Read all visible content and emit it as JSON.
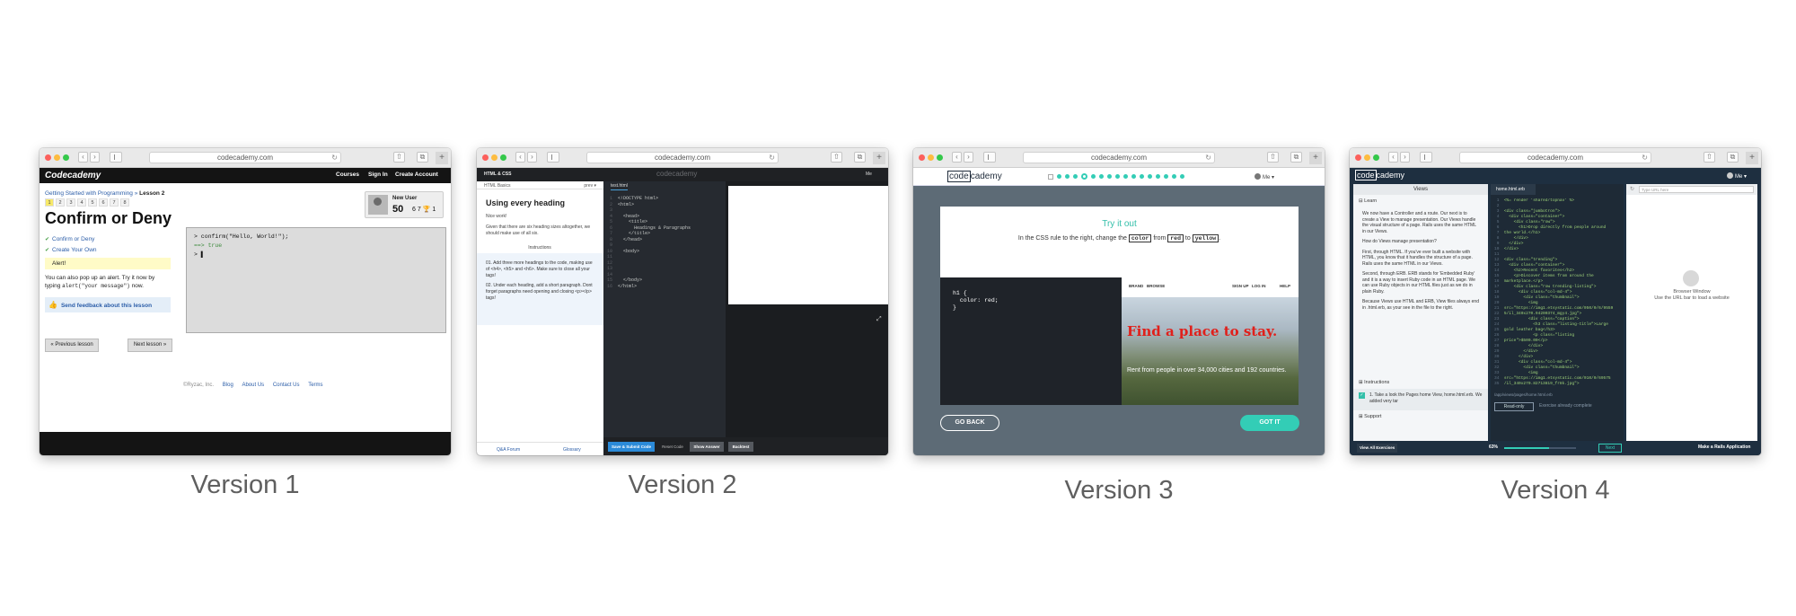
{
  "url": "codecademy.com",
  "captions": [
    "Version 1",
    "Version 2",
    "Version 3",
    "Version 4"
  ],
  "v1": {
    "logo": "Codecademy",
    "nav": [
      "Courses",
      "Sign In",
      "Create Account"
    ],
    "breadcrumb_link": "Getting Started with Programming",
    "breadcrumb_sep": " » ",
    "breadcrumb_current": "Lesson 2",
    "steps": [
      "1",
      "2",
      "3",
      "4",
      "5",
      "6",
      "7",
      "8"
    ],
    "title": "Confirm or Deny",
    "user_name": "New User",
    "points": "50",
    "badges": "6 7 🏆 1",
    "list": [
      "Confirm or Deny",
      "Create Your Own",
      "Alert!"
    ],
    "desc_1": "You can also pop up an alert. Try it now by typing ",
    "desc_code": "alert(\"your message\")",
    "desc_2": " now.",
    "feedback": "Send feedback about this lesson",
    "prev": "« Previous lesson",
    "next": "Next lesson »",
    "console": [
      "> confirm(\"Hello, World!\");",
      "==> true",
      "> ▌"
    ],
    "footer_copy": "©Ryzac, Inc.",
    "footer_links": [
      "Blog",
      "About Us",
      "Contact Us",
      "Terms"
    ]
  },
  "v2": {
    "top_title": "HTML & CSS",
    "logo": "codecademy",
    "me": "Me",
    "course": "HTML Basics",
    "progress": "prev ▾",
    "heading": "Using every heading",
    "p1": "Nice work!",
    "p2": "Given that there are six heading sizes altogether, we should make use of all six.",
    "instructions_label": "Instructions",
    "instr1": "01. Add three more headings to the code, making use of <h4>, <h5> and <h6>. Make sure to close all your tags!",
    "instr2": "02. Under each heading, add a short paragraph. Dont forget paragraphs need opening and closing <p></p> tags!",
    "qa": "Q&A Forum",
    "glossary": "Glossary",
    "tab": "test.html",
    "code": [
      "<!DOCTYPE html>",
      "<html>",
      "",
      "  <head>",
      "    <title>",
      "      Headings & Paragraphs",
      "    </title>",
      "  </head>",
      "",
      "  <body>",
      "",
      "",
      "",
      "",
      "  </body>",
      "</html>"
    ],
    "submit": "Save & Submit Code",
    "reset": "Reset Code",
    "answer": "Show Answer",
    "back": "Backtest"
  },
  "v3": {
    "logo_box": "code",
    "logo_rest": "cademy",
    "me": "Me ▾",
    "try_it": "Try it out",
    "instr_1": "In the CSS rule to the right, change the ",
    "chip_1": "color",
    "instr_2": " from ",
    "chip_2": "red",
    "instr_3": " to ",
    "chip_3": "yellow",
    "instr_4": ".",
    "code": "h1 {\n  color: red;\n}",
    "site_nav": [
      "BRAND",
      "BROWSE",
      "SIGN UP",
      "LOG IN",
      "HELP"
    ],
    "hero_heading": "Find a place to stay.",
    "hero_text": "Rent from people in over 34,000 cities and 192 countries.",
    "go_back": "GO BACK",
    "got_it": "GOT IT"
  },
  "v4": {
    "logo_box": "code",
    "logo_rest": "cademy",
    "me": "Me ▾",
    "views": "Views",
    "learn": "Learn",
    "paragraphs": [
      "We now have a Controller and a route. Our next is to create a View to manage presentation. Our Views handle the visual structure of a page. Rails uses the same HTML in our Views.",
      "How do Views manage presentation?",
      "First, through HTML. If you've ever built a website with HTML, you know that it handles the structure of a page. Rails uses the same HTML in our Views.",
      "Second, through ERB. ERB stands for 'Embedded Ruby' and it is a way to insert Ruby code in an HTML page. We can use Ruby objects in our HTML files just as we do in plain Ruby.",
      "Because Views use HTML and ERB, View files always end in .html.erb, as your see in the file to the right."
    ],
    "instructions": "Instructions",
    "task": "1. Take a look the Pages home View, home.html.erb. We added very tar",
    "support": "Support",
    "file": "home.html.erb",
    "code": [
      "<%= render 'shared/topnav' %>",
      "",
      "<div class=\"jumbotron\">",
      "  <div class=\"container\">",
      "    <div class=\"row\">",
      "      <h1>Drop directly from people around",
      "the world.</h1>",
      "    </div>",
      "  </div>",
      "</div>",
      "",
      "<div class=\"trending\">",
      "  <div class=\"container\">",
      "    <h2>Recent favorites</h2>",
      "    <p>Discover items from around the",
      "marketplace.</p>",
      "    <div class=\"row trending-listing\">",
      "      <div class=\"col-md-4\">",
      "        <div class=\"thumbnail\">",
      "          <img",
      "src=\"https://img1.etsystatic.com/050/0/6/9559",
      "5/il_340x270.94200374_mgy4.jpg\">",
      "          <div class=\"caption\">",
      "            <h3 class=\"listing-title\">Large",
      "gold leather bag</h3>",
      "            <p class=\"listing",
      "price\">$500.00</p>",
      "          </div>",
      "        </div>",
      "      </div>",
      "      <div class=\"col-md-4\">",
      "        <div class=\"thumbnail\">",
      "          <img",
      "src=\"https://img1.etsystatic.com/010/0/69575",
      "/il_340x270.82713819_fr8k.jpg\">"
    ],
    "path": "/app/views/pages/home.html.erb",
    "read_only": "Read-only",
    "complete": "Exercise already complete",
    "url_placeholder": "Type URL here",
    "bw_title": "Browser Window",
    "bw_sub": "Use the URL bar to load a website",
    "all_exercises": "View All Exercises",
    "pct": "63%",
    "progress": 0.63,
    "next": "Next",
    "course": "Make a Rails Application"
  }
}
